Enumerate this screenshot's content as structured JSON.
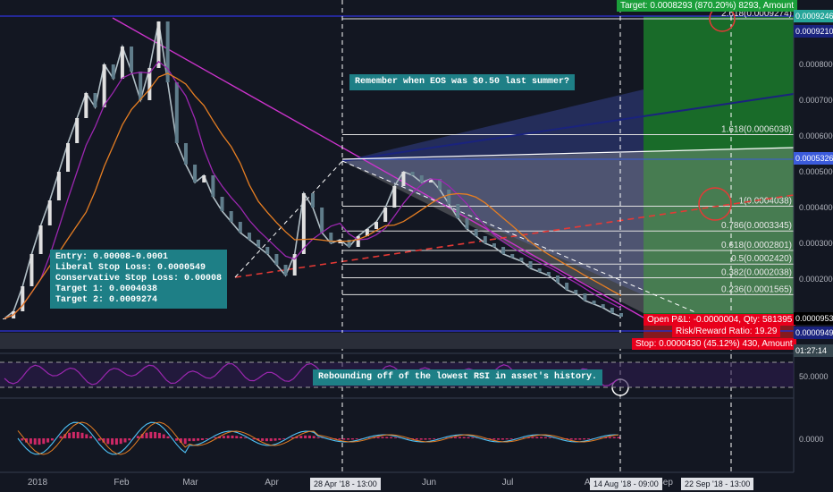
{
  "target_label": "Target: 0.0008293 (870.20%) 8293, Amount",
  "stop_label": "Stop: 0.0000430 (45.12%) 430, Amount",
  "pnl_label": "Open P&L: -0.0000004, Qty: 581395",
  "rr_label": "Risk/Reward Ratio: 19.29",
  "note_eos": "Remember when EOS was $0.50 last summer?",
  "note_rsi": "Rebounding off of the lowest RSI in asset's history.",
  "note_entry": "Entry: 0.00008-0.0001\nLiberal Stop Loss: 0.0000549\nConservative Stop Loss: 0.00008\nTarget 1: 0.0004038\nTarget 2: 0.0009274",
  "date_tags": [
    "28 Apr '18 - 13:00",
    "14 Aug '18 - 09:00",
    "22 Sep '18 - 13:00"
  ],
  "price_tags": [
    {
      "text": "0.0009246",
      "color": "#26a69a"
    },
    {
      "text": "0.0009210",
      "color": "#1a237e"
    },
    {
      "text": "0.0005326",
      "color": "#3b5bdb"
    },
    {
      "text": "0.0000953",
      "color": "#000000"
    },
    {
      "text": "0.0000949",
      "color": "#1a237e"
    },
    {
      "text": "01:27:14",
      "color": "#37474f"
    }
  ],
  "chart_data": {
    "type": "line",
    "y_ticks": [
      "0.0008000",
      "0.0007000",
      "0.0006000",
      "0.0005000",
      "0.0004000",
      "0.0003000",
      "0.0002000"
    ],
    "x_ticks": [
      "2018",
      "Feb",
      "Mar",
      "Apr",
      "Jun",
      "Jul",
      "Au",
      "Sep"
    ],
    "fib_levels": [
      {
        "label": "2.618(0.0009274)",
        "value": 0.0009274
      },
      {
        "label": "1.618(0.0006038)",
        "value": 0.0006038
      },
      {
        "label": "1(0.0004038)",
        "value": 0.0004038
      },
      {
        "label": "0.786(0.0003345)",
        "value": 0.0003345
      },
      {
        "label": "0.618(0.0002801)",
        "value": 0.0002801
      },
      {
        "label": "0.5(0.0002420)",
        "value": 0.000242
      },
      {
        "label": "0.382(0.0002038)",
        "value": 0.0002038
      },
      {
        "label": "0.236(0.0001565)",
        "value": 0.0001565
      }
    ],
    "rsi_ticks": [
      "50.0000"
    ],
    "macd_ticks": [
      "0.0000"
    ],
    "price_series": [
      9e-05,
      0.00011,
      0.00018,
      0.00027,
      0.00035,
      0.00042,
      0.0005,
      0.00058,
      0.00065,
      0.00072,
      0.00068,
      0.0008,
      0.00076,
      0.00085,
      0.00078,
      0.0007,
      0.00079,
      0.00092,
      0.00075,
      0.00058,
      0.00052,
      0.00047,
      0.00049,
      0.00043,
      0.00039,
      0.00036,
      0.00033,
      0.00031,
      0.00029,
      0.00027,
      0.00024,
      0.00021,
      0.00027,
      0.00044,
      0.0004,
      0.00033,
      0.0003,
      0.00031,
      0.00029,
      0.00032,
      0.00034,
      0.00036,
      0.0004,
      0.00046,
      0.0005,
      0.00049,
      0.00047,
      0.00048,
      0.00045,
      0.00041,
      0.00037,
      0.00034,
      0.00032,
      0.0003,
      0.00029,
      0.00027,
      0.00026,
      0.00025,
      0.00023,
      0.00022,
      0.00021,
      0.00019,
      0.00017,
      0.00016,
      0.00014,
      0.00013,
      0.00012,
      0.000105,
      9.5e-05
    ]
  }
}
